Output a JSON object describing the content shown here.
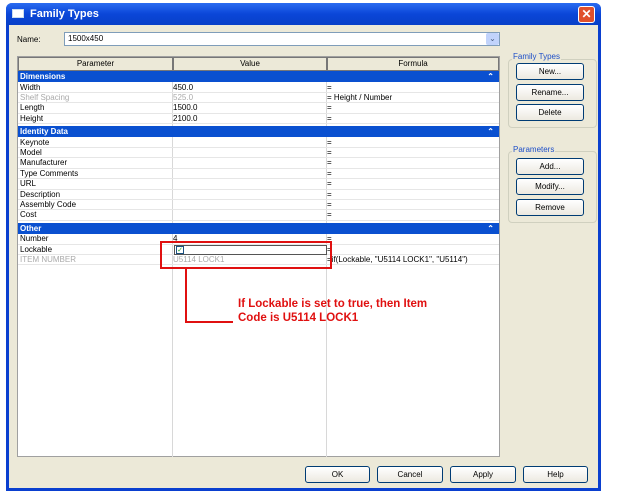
{
  "window": {
    "title": "Family Types",
    "close": "✕"
  },
  "name": {
    "label": "Name:",
    "value": "1500x450"
  },
  "table": {
    "headers": [
      "Parameter",
      "Value",
      "Formula"
    ],
    "groups": [
      {
        "title": "Dimensions",
        "rows": [
          {
            "param": "Width",
            "value": "450.0",
            "formula": "="
          },
          {
            "param": "Shelf Spacing",
            "value": "525.0",
            "formula": "= Height / Number"
          },
          {
            "param": "Length",
            "value": "1500.0",
            "formula": "="
          },
          {
            "param": "Height",
            "value": "2100.0",
            "formula": "="
          }
        ]
      },
      {
        "title": "Identity Data",
        "rows": [
          {
            "param": "Keynote",
            "value": "",
            "formula": "="
          },
          {
            "param": "Model",
            "value": "",
            "formula": "="
          },
          {
            "param": "Manufacturer",
            "value": "",
            "formula": "="
          },
          {
            "param": "Type Comments",
            "value": "",
            "formula": "="
          },
          {
            "param": "URL",
            "value": "",
            "formula": "="
          },
          {
            "param": "Description",
            "value": "",
            "formula": "="
          },
          {
            "param": "Assembly Code",
            "value": "",
            "formula": "="
          },
          {
            "param": "Cost",
            "value": "",
            "formula": "="
          }
        ]
      },
      {
        "title": "Other",
        "rows": [
          {
            "param": "Number",
            "value": "4",
            "formula": "="
          },
          {
            "param": "Lockable",
            "value": "",
            "formula": "=",
            "checked": true
          },
          {
            "param": "ITEM NUMBER",
            "value": "U5114 LOCK1",
            "formula": "=if(Lockable, \"U5114 LOCK1\", \"U5114\")"
          }
        ]
      }
    ]
  },
  "family_types": {
    "label": "Family Types",
    "new": "New...",
    "rename": "Rename...",
    "delete": "Delete"
  },
  "parameters": {
    "label": "Parameters",
    "add": "Add...",
    "modify": "Modify...",
    "remove": "Remove"
  },
  "footer": {
    "ok": "OK",
    "cancel": "Cancel",
    "apply": "Apply",
    "help": "Help"
  },
  "annotation": {
    "line1": "If Lockable is set to true, then Item",
    "line2": "Code is U5114 LOCK1"
  }
}
